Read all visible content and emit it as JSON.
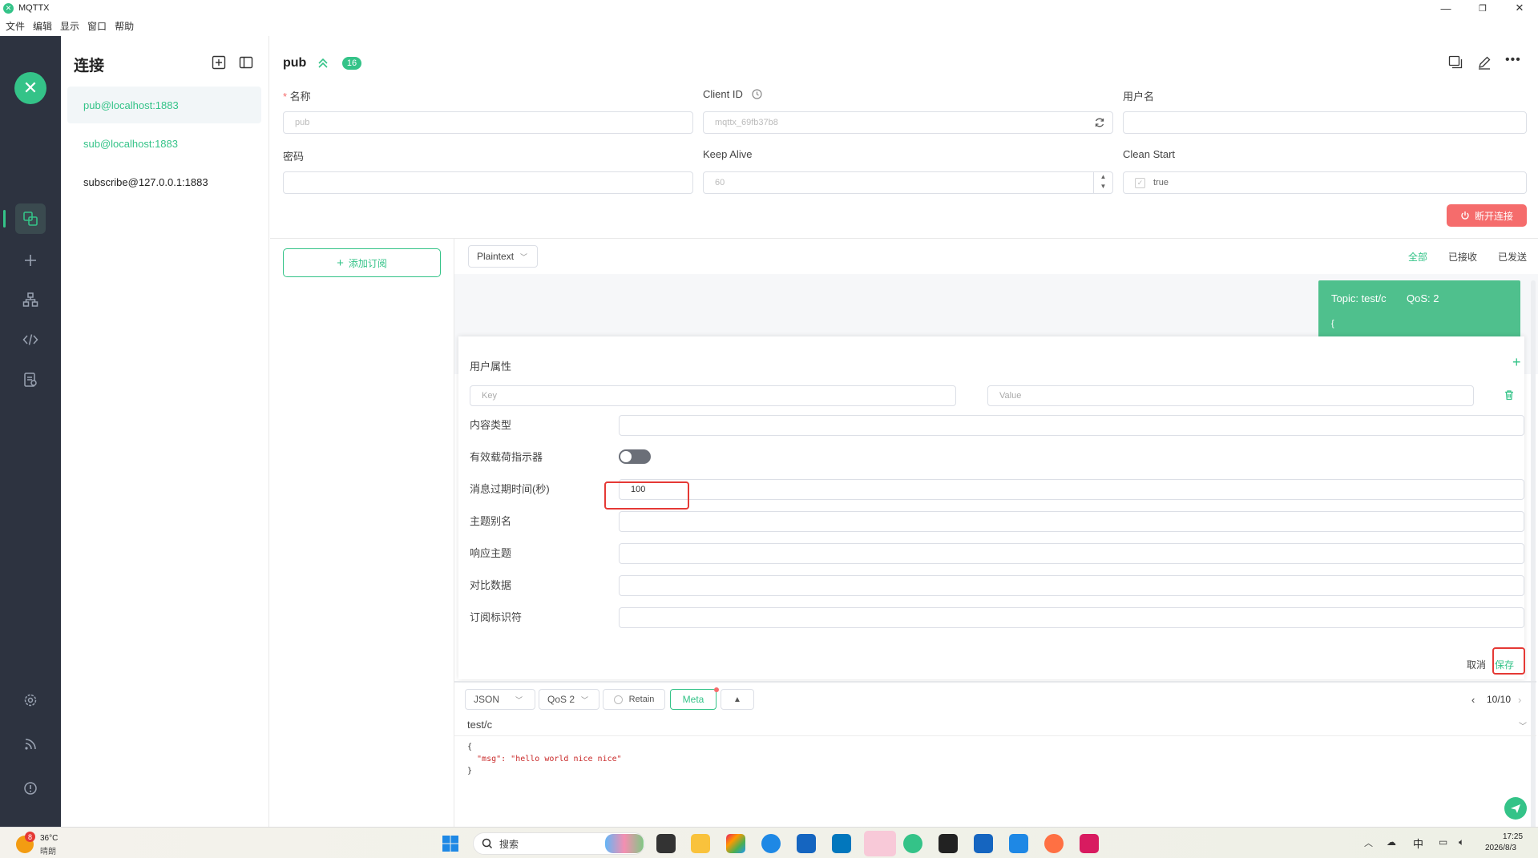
{
  "window": {
    "title": "MQTTX",
    "minimize": "—",
    "restore": "❐",
    "close": "✕"
  },
  "menu": [
    "文件",
    "编辑",
    "显示",
    "窗口",
    "帮助"
  ],
  "sidebar": {
    "logo": "✕"
  },
  "connections": {
    "title": "连接",
    "items": [
      {
        "label": "pub@localhost:1883",
        "color": "#34c388"
      },
      {
        "label": "sub@localhost:1883",
        "color": "#34c388"
      },
      {
        "label": "subscribe@127.0.0.1:1883",
        "color": "#222222"
      }
    ]
  },
  "header": {
    "name": "pub",
    "badge": "16"
  },
  "form": {
    "name_label": "名称",
    "name_value": "pub",
    "clientid_label": "Client ID",
    "clientid_value": "mqttx_69fb37b8",
    "username_label": "用户名",
    "password_label": "密码",
    "keepalive_label": "Keep Alive",
    "keepalive_value": "60",
    "cleanstart_label": "Clean Start",
    "cleanstart_value": "true",
    "disconnect": "断开连接"
  },
  "subscriptions": {
    "add": "添加订阅"
  },
  "messages": {
    "format": "Plaintext",
    "filters": [
      "全部",
      "已接收",
      "已发送"
    ],
    "bubble_topic": "Topic: test/c",
    "bubble_qos": "QoS: 2",
    "bubble_body": "{"
  },
  "meta": {
    "user_props_label": "用户属性",
    "key_placeholder": "Key",
    "value_placeholder": "Value",
    "content_type_label": "内容类型",
    "payload_indicator_label": "有效载荷指示器",
    "expiry_label": "消息过期时间(秒)",
    "expiry_value": "100",
    "topic_alias_label": "主题别名",
    "response_topic_label": "响应主题",
    "correlation_label": "对比数据",
    "sub_id_label": "订阅标识符",
    "cancel": "取消",
    "save": "保存"
  },
  "publish": {
    "format": "JSON",
    "qos": "QoS 2",
    "retain": "Retain",
    "meta": "Meta",
    "pager": "10/10",
    "topic": "test/c",
    "payload_lines": [
      "{",
      "  \"msg\": \"hello world nice nice\"",
      "}"
    ]
  },
  "taskbar": {
    "weather_temp": "36°C",
    "weather_desc": "晴朗",
    "weather_badge": "8",
    "search": "搜索",
    "ime": "中",
    "time": "17:25",
    "date": "2026/8/3"
  }
}
